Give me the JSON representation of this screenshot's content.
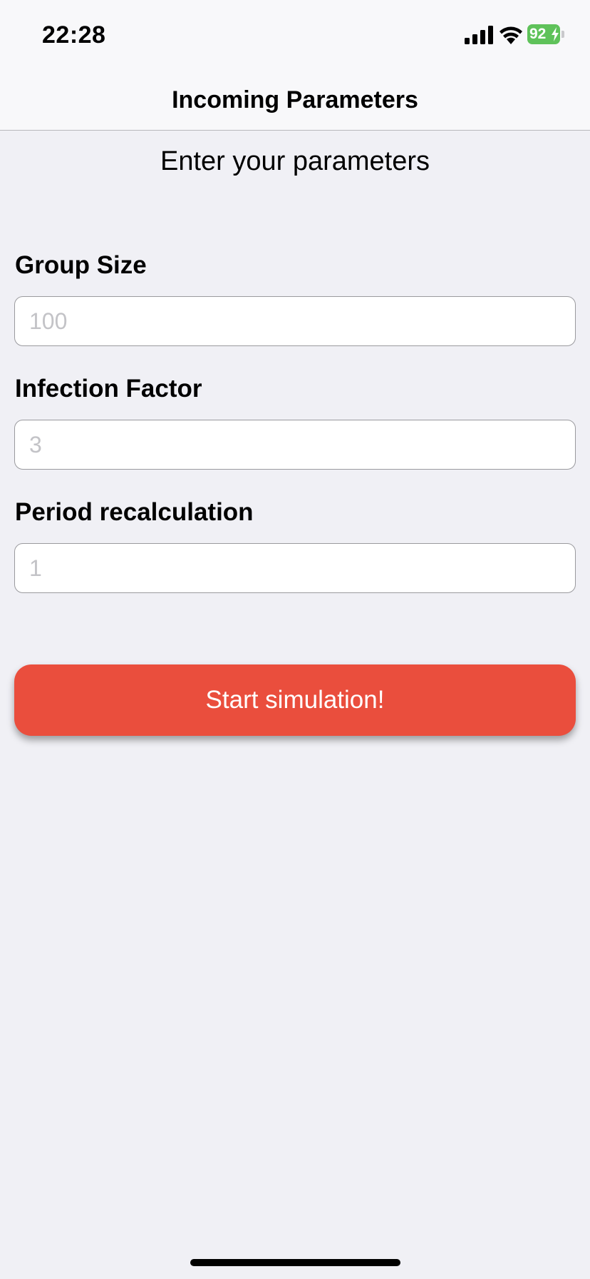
{
  "status_bar": {
    "time": "22:28",
    "battery_level": "92",
    "battery_charging": true,
    "battery_color": "#5fc25a",
    "icons": [
      "signal-icon",
      "wifi-icon",
      "battery-icon"
    ]
  },
  "nav": {
    "title": "Incoming Parameters"
  },
  "form": {
    "subtitle": "Enter your parameters",
    "fields": [
      {
        "label": "Group Size",
        "value": "",
        "placeholder": "100"
      },
      {
        "label": "Infection Factor",
        "value": "",
        "placeholder": "3"
      },
      {
        "label": "Period recalculation",
        "value": "",
        "placeholder": "1"
      }
    ],
    "submit_label": "Start simulation!",
    "submit_color": "#ea4e3d"
  },
  "colors": {
    "background": "#f0f0f5",
    "bar_background": "#f8f8fa"
  }
}
